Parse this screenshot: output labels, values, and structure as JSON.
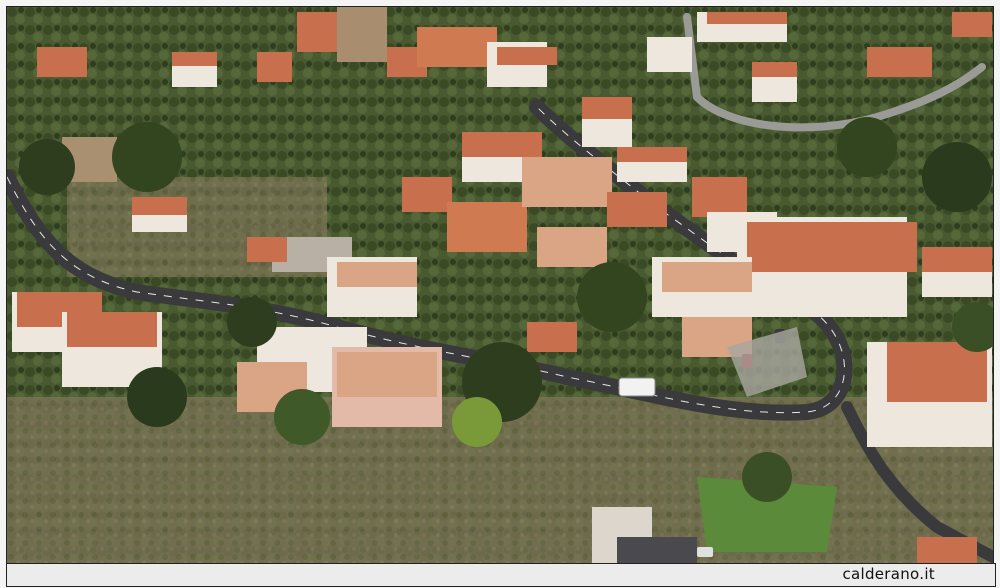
{
  "photo": {
    "subject": "aerial-photo-hillside-village",
    "palette": {
      "vegetation_dark": "#3b4a2a",
      "vegetation_mid": "#5e6d3d",
      "dry_ground": "#8a7b5c",
      "road": "#3a3a3c",
      "road_line": "#e8e8e8",
      "roof_terracotta": "#c8704e",
      "roof_light": "#d9a585",
      "wall_white": "#ede7de",
      "wall_pink": "#e3b9a8"
    }
  },
  "watermark": {
    "text": "calderano.it"
  }
}
